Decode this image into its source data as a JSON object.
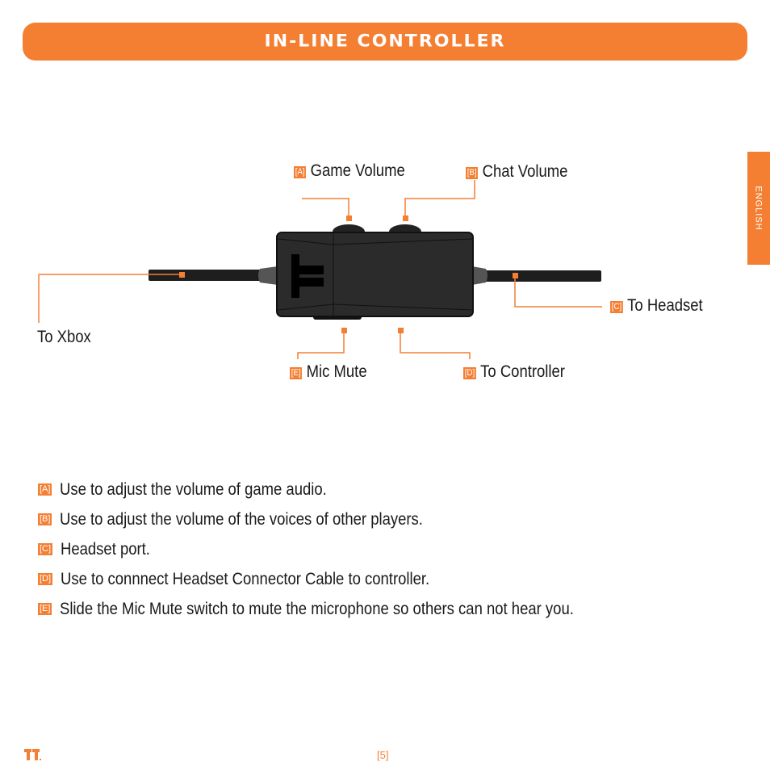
{
  "header": {
    "title": "IN-LINE CONTROLLER"
  },
  "side_tab": {
    "label": "ENGLISH"
  },
  "colors": {
    "accent": "#f47f33",
    "device_body": "#2b2b2b",
    "cable": "#1e1e1e"
  },
  "diagram": {
    "callouts": [
      {
        "badge": "[A]",
        "label": "Game Volume"
      },
      {
        "badge": "[B]",
        "label": "Chat Volume"
      },
      {
        "badge": "[C]",
        "label": "To Headset"
      },
      {
        "badge": "[D]",
        "label": "To Controller"
      },
      {
        "badge": "[E]",
        "label": "Mic Mute"
      }
    ],
    "to_xbox": "To Xbox"
  },
  "descriptions": [
    {
      "badge": "[A]",
      "text": "Use to adjust the volume of game audio."
    },
    {
      "badge": "[B]",
      "text": "Use to adjust the volume of the voices of other players."
    },
    {
      "badge": "[C]",
      "text": "Headset port."
    },
    {
      "badge": "[D]",
      "text": "Use to connnect Headset Connector Cable to controller."
    },
    {
      "badge": "[E]",
      "text": "Slide the Mic Mute switch to mute the microphone so others can not hear you."
    }
  ],
  "footer": {
    "page_number": "[5]",
    "logo": "tritton-logo"
  }
}
